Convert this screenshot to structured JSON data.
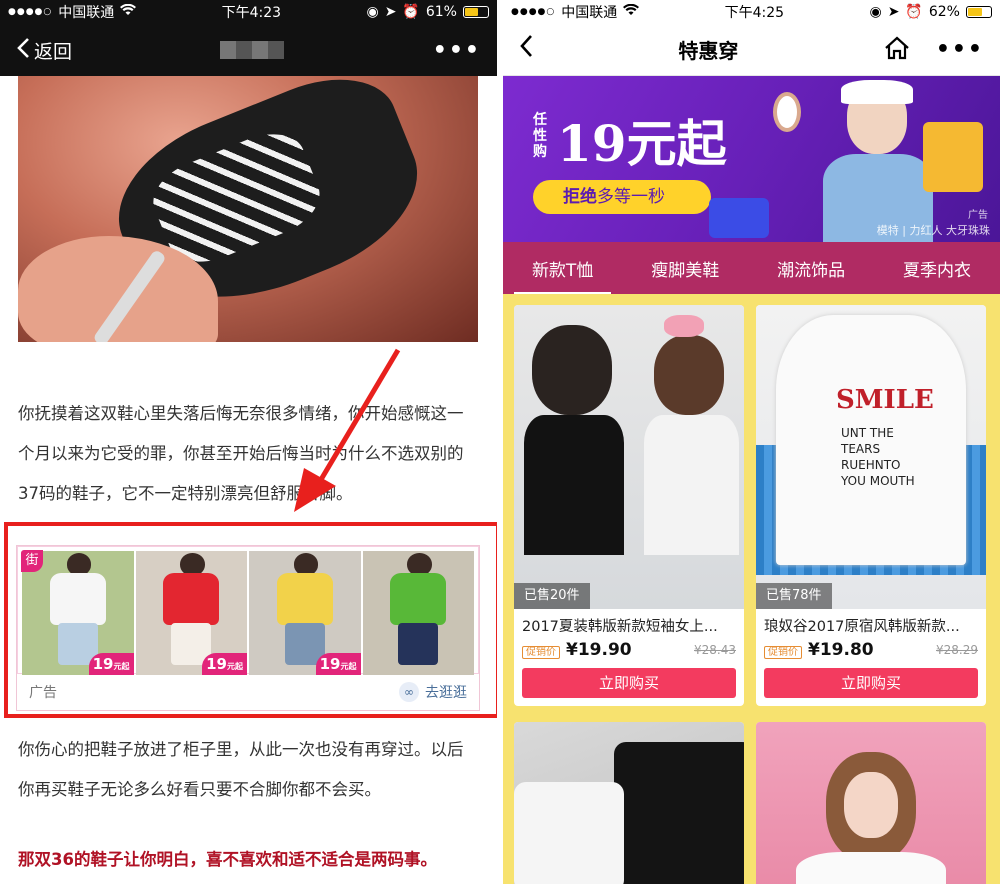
{
  "left": {
    "status": {
      "carrier": "中国联通",
      "time": "下午4:23",
      "battery": "61%"
    },
    "nav": {
      "back_label": "返回",
      "more_label": "•••"
    },
    "article": {
      "para1": "你抚摸着这双鞋心里失落后悔无奈很多情绪，你开始感慨这一个月以来为它受的罪，你甚至开始后悔当时为什么不选双别的37码的鞋子，它不一定特别漂亮但舒服合脚。",
      "para2": "你伤心的把鞋子放进了柜子里，从此一次也没有再穿过。以后你再买鞋子无论多么好看只要不合脚你都不会买。",
      "para3": "那双36的鞋子让你明白，喜不喜欢和适不适合是两码事。"
    },
    "ad": {
      "badge": "街",
      "tiles": [
        {
          "price": "19",
          "shirt_color": "#f6f6f6",
          "pants_color": "#b9cfe2",
          "bg": "#b3c68f"
        },
        {
          "price": "19",
          "shirt_color": "#e32630",
          "pants_color": "#f4efe8",
          "bg": "#d7cfc4"
        },
        {
          "price": "19",
          "shirt_color": "#f2d24a",
          "pants_color": "#7b95b3",
          "bg": "#cfcac2"
        },
        {
          "price": "19",
          "shirt_color": "#58b838",
          "pants_color": "#25335a",
          "bg": "#c9c3b4"
        }
      ],
      "unit_label": "元起",
      "footer_label": "广告",
      "cta_label": "去逛逛"
    },
    "highlight_color": "#e8201d"
  },
  "right": {
    "status": {
      "carrier": "中国联通",
      "time": "下午4:25",
      "battery": "62%"
    },
    "nav": {
      "title": "特惠穿",
      "more_label": "•••"
    },
    "banner": {
      "vertical_label": "任性购",
      "headline": "19元起",
      "pill_bold": "拒绝",
      "pill_rest": "多等一秒",
      "ad_tag": "广告",
      "credit": "模特 | 力红人 大牙珠珠"
    },
    "tabs": [
      "新款T恤",
      "瘦脚美鞋",
      "潮流饰品",
      "夏季内衣"
    ],
    "products": [
      {
        "sold": "已售20件",
        "title": "2017夏装韩版新款短袖女上...",
        "promo": "促销价",
        "price": "¥19.90",
        "old_price": "¥28.43",
        "buy": "立即购买"
      },
      {
        "sold": "已售78件",
        "title": "琅奴谷2017原宿风韩版新款...",
        "promo": "促销价",
        "price": "¥19.80",
        "old_price": "¥28.29",
        "buy": "立即购买"
      }
    ],
    "theme": {
      "tab_bg": "#b02b63",
      "grid_bg": "#f7e26f",
      "buy_color": "#f33b5f"
    }
  }
}
